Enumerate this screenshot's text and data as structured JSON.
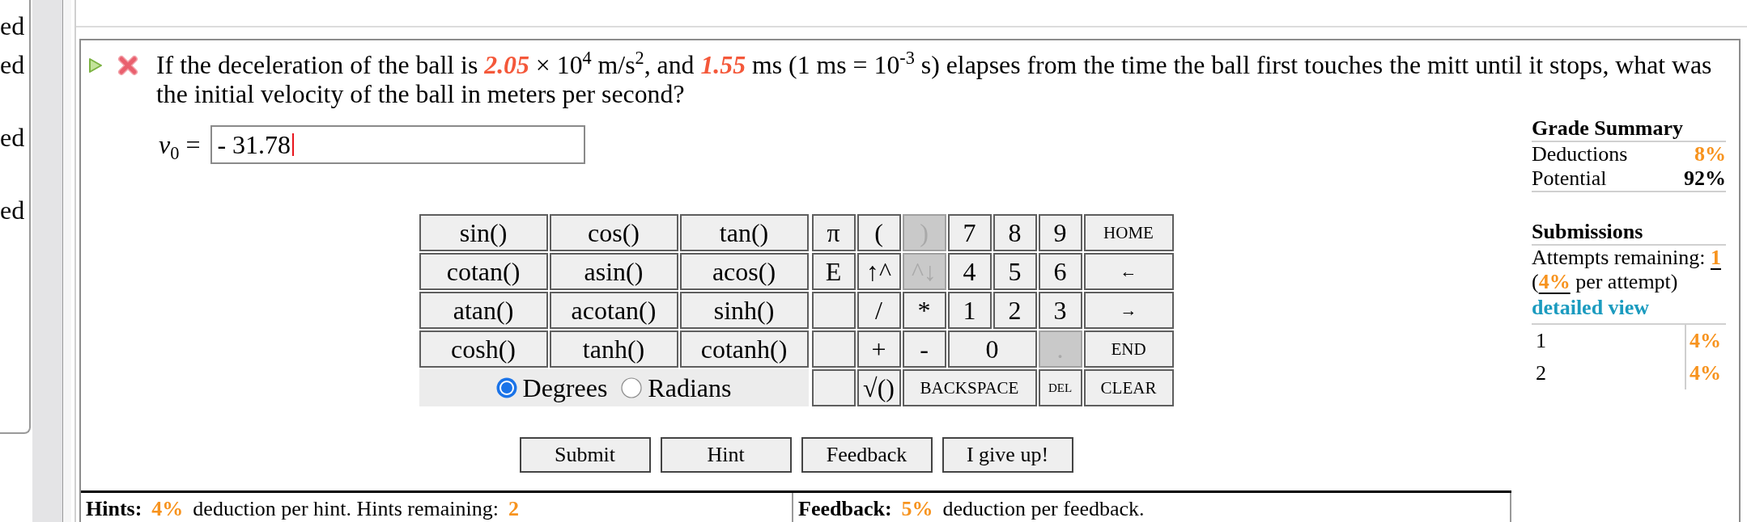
{
  "side_panel": {
    "items": [
      {
        "label": "ed"
      },
      {
        "label": "ed"
      },
      {
        "label": "ed"
      },
      {
        "label": "ed"
      }
    ]
  },
  "question": {
    "segments": [
      {
        "kind": "text",
        "text": "If the deceleration of the ball is "
      },
      {
        "kind": "variable",
        "text": "2.05"
      },
      {
        "kind": "text",
        "text": " × 10$^{4}$ m/s$^{2}$, and "
      },
      {
        "kind": "variable",
        "text": "1.55"
      },
      {
        "kind": "text",
        "text": " ms (1 ms = 10$^{-3}$ s) elapses from the time the ball first touches the mitt until it stops, what was the initial velocity of the ball in meters per second?"
      }
    ]
  },
  "answer": {
    "label": "*v*$_{0}$ =",
    "value": "- 31.78"
  },
  "grade_summary": {
    "title": "Grade Summary",
    "rows": [
      {
        "label": "Deductions",
        "value": "8%",
        "kind": "deduction"
      },
      {
        "label": "Potential",
        "value": "92%",
        "kind": "total"
      }
    ]
  },
  "submissions": {
    "title": "Submissions",
    "attempts": "Attempts remaining: **1** (**4%** per attempt)",
    "link": "detailed view",
    "history": [
      {
        "attempt": "1",
        "deduction": "4%"
      },
      {
        "attempt": "2",
        "deduction": "4%"
      }
    ]
  },
  "calculator": {
    "functions": [
      "sin()",
      "cos()",
      "tan()",
      "cotan()",
      "asin()",
      "acos()",
      "atan()",
      "acotan()",
      "sinh()",
      "cosh()",
      "tanh()",
      "cotanh()"
    ],
    "angle_modes": [
      {
        "label": "Degrees",
        "selected": true
      },
      {
        "label": "Radians",
        "selected": false
      }
    ],
    "keypad": {
      "rows": [
        {
          "keys": [
            {
              "label": "π",
              "kind": "key",
              "disabled": false
            },
            {
              "label": "(",
              "kind": "key",
              "disabled": false
            },
            {
              "label": ")",
              "kind": "key",
              "disabled": true
            },
            {
              "label": "7",
              "kind": "key",
              "disabled": false
            },
            {
              "label": "8",
              "kind": "key",
              "disabled": false
            },
            {
              "label": "9",
              "kind": "key",
              "disabled": false
            },
            {
              "label": "HOME",
              "kind": "command",
              "disabled": false
            }
          ]
        },
        {
          "keys": [
            {
              "label": "E",
              "kind": "key",
              "disabled": false
            },
            {
              "label": "↑^",
              "kind": "key",
              "disabled": false
            },
            {
              "label": "^↓",
              "kind": "key",
              "disabled": true
            },
            {
              "label": "4",
              "kind": "key",
              "disabled": false
            },
            {
              "label": "5",
              "kind": "key",
              "disabled": false
            },
            {
              "label": "6",
              "kind": "key",
              "disabled": false
            },
            {
              "label": "←",
              "kind": "command",
              "disabled": false
            }
          ]
        },
        {
          "keys": [
            {
              "kind": "blank",
              "disabled": false
            },
            {
              "label": "/",
              "kind": "key",
              "disabled": false
            },
            {
              "label": "*",
              "kind": "key",
              "disabled": false
            },
            {
              "label": "1",
              "kind": "key",
              "disabled": false
            },
            {
              "label": "2",
              "kind": "key",
              "disabled": false
            },
            {
              "label": "3",
              "kind": "key",
              "disabled": false
            },
            {
              "label": "→",
              "kind": "command",
              "disabled": false
            }
          ]
        },
        {
          "keys": [
            {
              "kind": "blank",
              "disabled": false
            },
            {
              "label": "+",
              "kind": "key",
              "disabled": false
            },
            {
              "label": "-",
              "kind": "key",
              "disabled": false
            },
            {
              "label": "0",
              "kind": "wide",
              "disabled": false
            },
            {
              "label": ".",
              "kind": "key",
              "disabled": true
            },
            {
              "label": "END",
              "kind": "command",
              "disabled": false
            }
          ]
        },
        {
          "keys": [
            {
              "kind": "blank",
              "disabled": false
            },
            {
              "label": "√()",
              "kind": "key",
              "disabled": false
            },
            {
              "label": "BACKSPACE",
              "kind": "long-command",
              "disabled": false
            },
            {
              "label": "DEL",
              "kind": "small",
              "disabled": false
            },
            {
              "label": "CLEAR",
              "kind": "command",
              "disabled": false
            }
          ]
        }
      ]
    }
  },
  "buttons": [
    "Submit",
    "Hint",
    "Feedback",
    "I give up!"
  ],
  "hints": {
    "label": "Hints:",
    "deduction": "4%",
    "text": "deduction per hint. Hints remaining:",
    "remaining": "2"
  },
  "feedback": {
    "label": "Feedback:",
    "deduction": "5%",
    "text": "deduction per feedback."
  }
}
